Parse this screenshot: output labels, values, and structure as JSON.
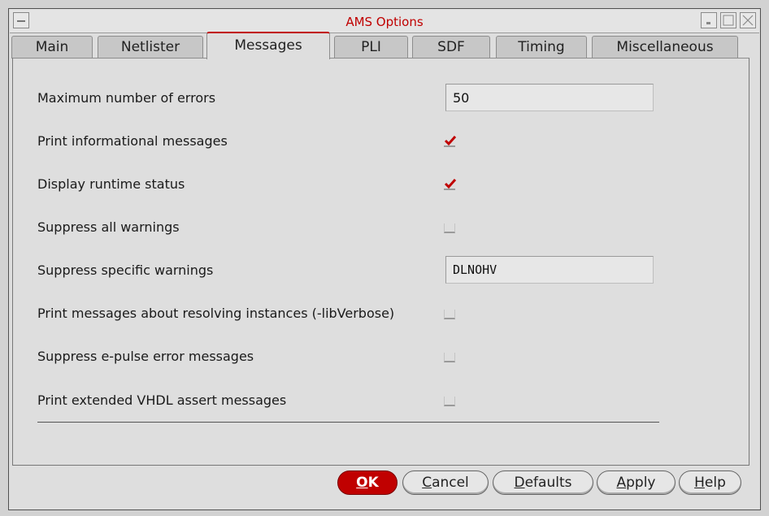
{
  "window": {
    "title": "AMS Options"
  },
  "tabs": [
    {
      "label": "Main"
    },
    {
      "label": "Netlister"
    },
    {
      "label": "Messages"
    },
    {
      "label": "PLI"
    },
    {
      "label": "SDF"
    },
    {
      "label": "Timing"
    },
    {
      "label": "Miscellaneous"
    }
  ],
  "active_tab": "Messages",
  "rows": {
    "max_errors": {
      "label": "Maximum number of errors",
      "value": "50"
    },
    "print_info": {
      "label": "Print informational messages",
      "checked": true
    },
    "display_runtime": {
      "label": "Display runtime status",
      "checked": true
    },
    "suppress_all": {
      "label": "Suppress all warnings",
      "checked": false
    },
    "suppress_specific": {
      "label": "Suppress specific warnings",
      "value": "DLNOHV"
    },
    "lib_verbose": {
      "label": "Print messages about resolving instances (-libVerbose)",
      "checked": false
    },
    "suppress_epulse": {
      "label": "Suppress e-pulse error messages",
      "checked": false
    },
    "vhdl_assert": {
      "label": "Print extended VHDL assert messages",
      "checked": false
    }
  },
  "buttons": {
    "ok": {
      "first": "O",
      "rest": "K"
    },
    "cancel": {
      "first": "C",
      "rest": "ancel"
    },
    "defaults": {
      "first": "D",
      "rest": "efaults"
    },
    "apply": {
      "first": "A",
      "rest": "pply"
    },
    "help": {
      "first": "H",
      "rest": "elp"
    }
  },
  "colors": {
    "accent": "#c00000"
  }
}
